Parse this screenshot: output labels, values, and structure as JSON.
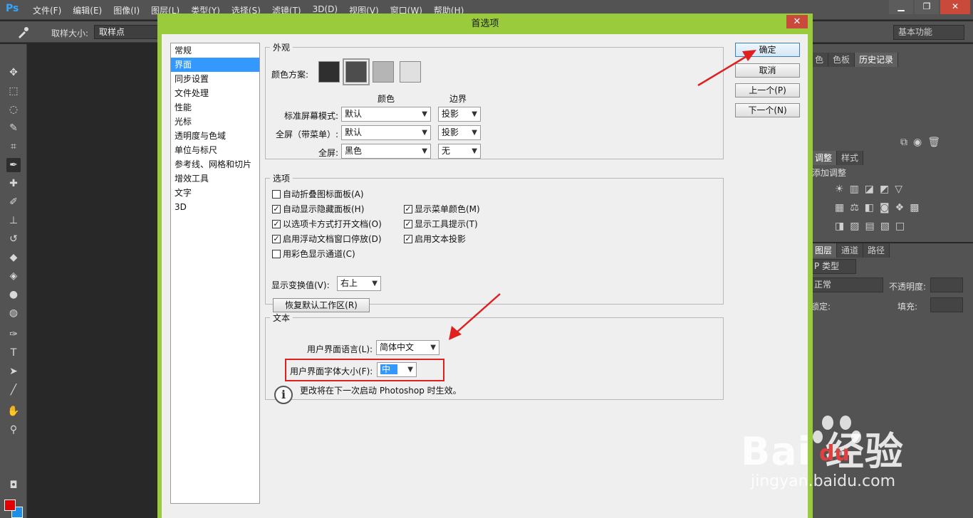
{
  "app": {
    "logo": "Ps"
  },
  "menu": [
    "文件(F)",
    "编辑(E)",
    "图像(I)",
    "图层(L)",
    "类型(Y)",
    "选择(S)",
    "滤镜(T)",
    "3D(D)",
    "视图(V)",
    "窗口(W)",
    "帮助(H)"
  ],
  "window_buttons": {
    "minimize": "▁",
    "restore": "❐",
    "close": "✕"
  },
  "options_bar": {
    "sample_size_label": "取样大小:",
    "sample_size_value": "取样点",
    "workspace": "基本功能"
  },
  "right_panels": {
    "top_tabs": [
      "色",
      "色板",
      "历史记录"
    ],
    "mid_tabs": [
      "调整",
      "样式"
    ],
    "mid_title": "添加调整",
    "layer_tabs": [
      "图层",
      "通道",
      "路径"
    ],
    "layer_kind": "P 类型",
    "blend_mode": "正常",
    "opacity_label": "不透明度:",
    "lock_label": "锁定:",
    "fill_label": "填充:"
  },
  "dialog": {
    "title": "首选项",
    "close": "✕",
    "categories": [
      "常规",
      "界面",
      "同步设置",
      "文件处理",
      "性能",
      "光标",
      "透明度与色域",
      "单位与标尺",
      "参考线、网格和切片",
      "增效工具",
      "文字",
      "3D"
    ],
    "selected_category": "界面",
    "appearance": {
      "legend": "外观",
      "color_scheme_label": "颜色方案:",
      "swatches": [
        "#2f2f2f",
        "#4d4d4d",
        "#b5b5b5",
        "#e0e0e0"
      ],
      "col_color": "颜色",
      "col_border": "边界",
      "rows": [
        {
          "label": "标准屏幕模式:",
          "color": "默认",
          "border": "投影"
        },
        {
          "label": "全屏（带菜单）:",
          "color": "默认",
          "border": "投影"
        },
        {
          "label": "全屏:",
          "color": "黑色",
          "border": "无"
        }
      ]
    },
    "options": {
      "legend": "选项",
      "checks": [
        {
          "label": "自动折叠图标面板(A)",
          "checked": false
        },
        {
          "label": "自动显示隐藏面板(H)",
          "checked": true
        },
        {
          "label": "以选项卡方式打开文档(O)",
          "checked": true
        },
        {
          "label": "启用浮动文档窗口停放(D)",
          "checked": true
        },
        {
          "label": "用彩色显示通道(C)",
          "checked": false
        },
        {
          "label": "显示菜单颜色(M)",
          "checked": true
        },
        {
          "label": "显示工具提示(T)",
          "checked": true
        },
        {
          "label": "启用文本投影",
          "checked": true
        }
      ],
      "transform_label": "显示变换值(V):",
      "transform_value": "右上",
      "restore_button": "恢复默认工作区(R)"
    },
    "text": {
      "legend": "文本",
      "lang_label": "用户界面语言(L):",
      "lang_value": "简体中文",
      "size_label": "用户界面字体大小(F):",
      "size_value": "中",
      "info": "更改将在下一次启动 Photoshop 时生效。"
    },
    "buttons": {
      "ok": "确定",
      "cancel": "取消",
      "prev": "上一个(P)",
      "next": "下一个(N)"
    }
  },
  "watermark": {
    "brand": "Bai 经验",
    "du": "du",
    "sub": "jingyan.baidu.com"
  },
  "colors": {
    "dialog_border": "#9acb3c",
    "selection": "#3399ff",
    "annotation": "#e02020"
  }
}
